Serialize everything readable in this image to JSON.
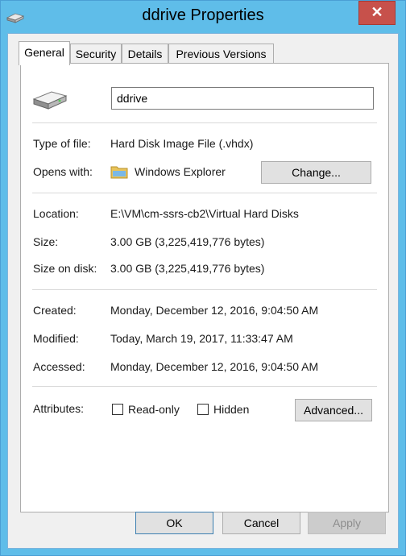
{
  "window": {
    "title": "ddrive Properties",
    "close_glyph": "✕"
  },
  "tabs": [
    {
      "label": "General",
      "active": true
    },
    {
      "label": "Security",
      "active": false
    },
    {
      "label": "Details",
      "active": false
    },
    {
      "label": "Previous Versions",
      "active": false
    }
  ],
  "general": {
    "file_name": "ddrive",
    "type_label": "Type of file:",
    "type_value": "Hard Disk Image File (.vhdx)",
    "opens_label": "Opens with:",
    "opens_value": "Windows Explorer",
    "change_button": "Change...",
    "location_label": "Location:",
    "location_value": "E:\\VM\\cm-ssrs-cb2\\Virtual Hard Disks",
    "size_label": "Size:",
    "size_value": "3.00 GB (3,225,419,776 bytes)",
    "size_on_disk_label": "Size on disk:",
    "size_on_disk_value": "3.00 GB (3,225,419,776 bytes)",
    "created_label": "Created:",
    "created_value": "Monday, December 12, 2016, 9:04:50 AM",
    "modified_label": "Modified:",
    "modified_value": "Today, March 19, 2017, 11:33:47 AM",
    "accessed_label": "Accessed:",
    "accessed_value": "Monday, December 12, 2016, 9:04:50 AM",
    "attributes_label": "Attributes:",
    "readonly_label": "Read-only",
    "readonly_checked": false,
    "hidden_label": "Hidden",
    "hidden_checked": false,
    "advanced_button": "Advanced..."
  },
  "footer": {
    "ok": "OK",
    "cancel": "Cancel",
    "apply": "Apply",
    "apply_enabled": false
  },
  "colors": {
    "titlebar": "#5fbde9",
    "close": "#c7514b",
    "folder": "#e8c35a"
  }
}
